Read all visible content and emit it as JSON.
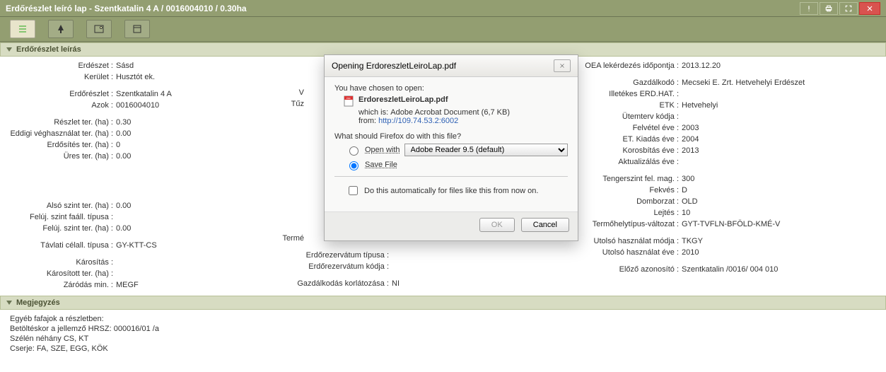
{
  "title": "Erdőrészlet leíró lap - Szentkatalin 4 A / 0016004010 / 0.30ha",
  "titlebar_buttons": {
    "warn": "!",
    "print": "print",
    "full": "full",
    "close": "×"
  },
  "sections": {
    "desc_header": "Erdőrészlet leírás",
    "notes_header": "Megjegyzés"
  },
  "left": {
    "erdeszet_l": "Erdészet :",
    "erdeszet_v": "Sásd",
    "kerulet_l": "Kerület :",
    "kerulet_v": "Husztót ek.",
    "erdoreszlet_l": "Erdőrészlet :",
    "erdoreszlet_v": "Szentkatalin 4 A",
    "azok_l": "Azok :",
    "azok_v": "0016004010",
    "reszletter_l": "Részlet ter. (ha) :",
    "reszletter_v": "0.30",
    "eddigi_l": "Eddigi véghasználat ter. (ha) :",
    "eddigi_v": "0.00",
    "erdosites_l": "Erdősítés ter. (ha) :",
    "erdosites_v": "0",
    "ures_l": "Üres ter. (ha) :",
    "ures_v": "0.00",
    "also_l": "Alsó szint ter. (ha) :",
    "also_v": "0.00",
    "felujtip_l": "Felúj. szint faáll. típusa :",
    "felujtip_v": "",
    "felujter_l": "Felúj. szint ter. (ha) :",
    "felujter_v": "0.00",
    "tavlati_l": "Távlati célall. típusa :",
    "tavlati_v": "GY-KTT-CS",
    "karositas_l": "Károsítás :",
    "karositas_v": "",
    "karositott_l": "Károsított ter. (ha) :",
    "karositott_v": "",
    "zarodas_l": "Záródás min. :",
    "zarodas_v": "MEGF"
  },
  "mid": {
    "v_l": "V",
    "tuz_l": "Tűz",
    "terme_l": "Termé",
    "rezt_l": "Erdőrezervátum típusa :",
    "rezt_v": "",
    "rezk_l": "Erdőrezervátum kódja :",
    "rezk_v": "",
    "gazd_l": "Gazdálkodás korlátozása :",
    "gazd_v": "NI"
  },
  "right": {
    "oea_l": "OEA lekérdezés időpontja :",
    "oea_v": "2013.12.20",
    "gazd_l": "Gazdálkodó :",
    "gazd_v": "Mecseki E. Zrt. Hetvehelyi Erdészet",
    "illet_l": "Illetékes ERD.HAT. :",
    "illet_v": "",
    "etk_l": "ETK :",
    "etk_v": "Hetvehelyi",
    "uterv_l": "Ütemterv kódja :",
    "uterv_v": "",
    "felv_l": "Felvétel éve :",
    "felv_v": "2003",
    "kiad_l": "ET. Kiadás éve :",
    "kiad_v": "2004",
    "koros_l": "Korosbítás éve :",
    "koros_v": "2013",
    "akt_l": "Aktualizálás éve :",
    "akt_v": "",
    "tenger_l": "Tengerszint fel. mag. :",
    "tenger_v": "300",
    "fekves_l": "Fekvés :",
    "fekves_v": "D",
    "domb_l": "Domborzat :",
    "domb_v": "OLD",
    "lejtes_l": "Lejtés :",
    "lejtes_v": "10",
    "termo_l": "Termőhelytípus-változat :",
    "termo_v": "GYT-TVFLN-BFÖLD-KMÉ-V",
    "uhmod_l": "Utolsó használat módja :",
    "uhmod_v": "TKGY",
    "uhev_l": "Utolsó használat éve :",
    "uhev_v": "2010",
    "elozo_l": "Előző azonosító :",
    "elozo_v": "Szentkatalin /0016/ 004 010"
  },
  "notes": {
    "l1": "Egyéb fafajok a részletben:",
    "l2": "Betöltéskor a jellemző HRSZ: 000016/01 /a",
    "l3": "Szélén néhány CS, KT",
    "l4": "Cserje: FA, SZE, EGG, KÖK"
  },
  "dialog": {
    "title": "Opening ErdoreszletLeiroLap.pdf",
    "intro": "You have chosen to open:",
    "filename": "ErdoreszletLeiroLap.pdf",
    "which_is": "which is:",
    "which_is_v": "Adobe Acrobat Document (6,7 KB)",
    "from": "from:",
    "from_v": "http://109.74.53.2:6002",
    "what_should": "What should Firefox do with this file?",
    "open_with": "Open with",
    "reader": "Adobe Reader 9.5 (default)",
    "save_file": "Save File",
    "do_auto": "Do this automatically for files like this from now on.",
    "ok": "OK",
    "cancel": "Cancel"
  }
}
